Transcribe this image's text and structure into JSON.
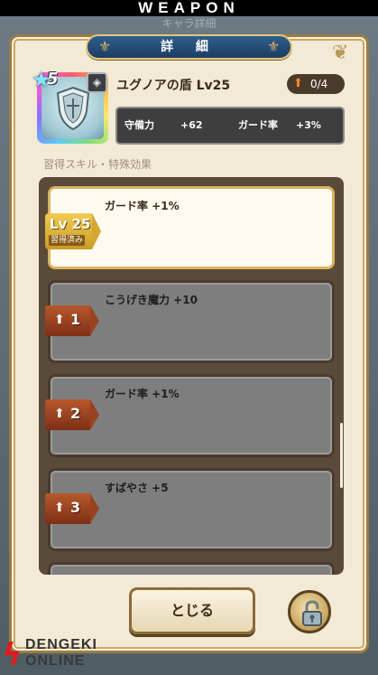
{
  "header": {
    "title": "WEAPON"
  },
  "background": {
    "ghost_title": "キャラ詳細"
  },
  "dialog": {
    "title": "詳 細",
    "item": {
      "rarity": "5",
      "name": "ユグノアの盾 Lv25",
      "upgrade_counter": "0/4"
    },
    "stats": {
      "defense_label": "守備力",
      "defense_value": "+62",
      "guard_label": "ガード率",
      "guard_value": "+3%"
    },
    "skills_header": "習得スキル・特殊効果",
    "skills": [
      {
        "badge_level": "Lv 25",
        "badge_status": "習得済み",
        "text": "ガード率 +1%"
      },
      {
        "badge": "1",
        "text": "こうげき魔力 +10"
      },
      {
        "badge": "2",
        "text": "ガード率 +1%"
      },
      {
        "badge": "3",
        "text": "すばやさ +5"
      }
    ],
    "close_label": "とじる"
  },
  "watermark": {
    "line1": "DENGEKI",
    "line2": "ONLINE"
  },
  "colors": {
    "accent_blue": "#1b3d63",
    "gold_border": "#d8b45c",
    "upgrade_orange": "#ff8a2a",
    "tag_red": "#b8582b"
  },
  "icons": [
    "shield-icon",
    "emblem-icon",
    "star-icon",
    "up-arrow-icon",
    "lock-icon"
  ]
}
